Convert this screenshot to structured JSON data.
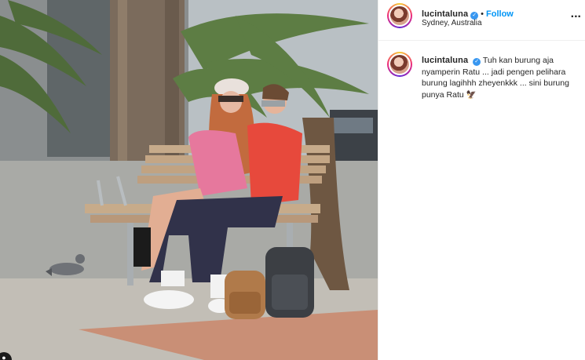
{
  "post": {
    "username": "lucintaluna",
    "follow_label": "Follow",
    "separator": "•",
    "location": "Sydney, Australia",
    "more_label": "...",
    "caption": "Tuh kan burung aja nyamperin Ratu ... jadi pengen pelihara burung lagihhh zheyenkkk ... sini burung punya Ratu",
    "caption_emoji": "🦅"
  },
  "icons": {
    "verified": "verified-badge-icon",
    "more": "more-options-icon",
    "avatar": "profile-avatar"
  },
  "colors": {
    "follow": "#0095f6",
    "verified": "#3897f0",
    "text": "#262626"
  }
}
